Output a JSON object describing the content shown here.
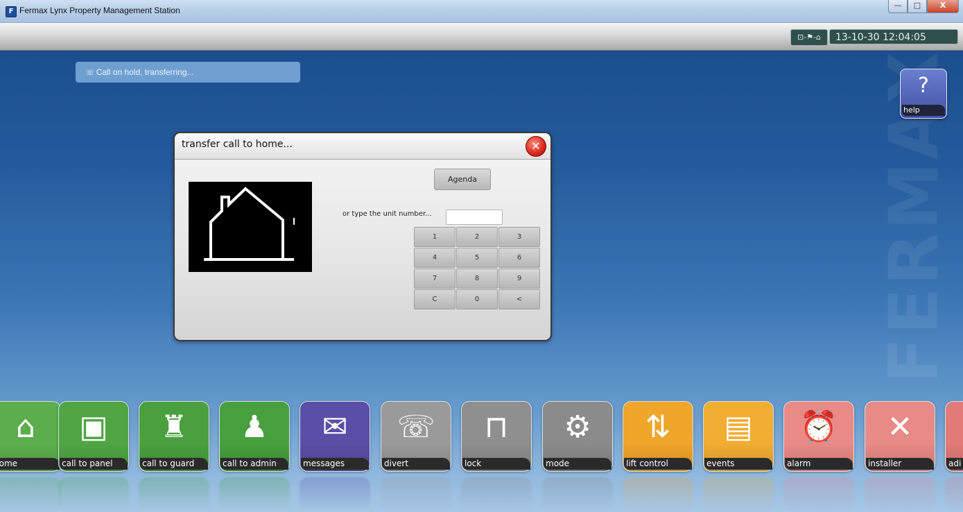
{
  "window": {
    "title": "Fermax Lynx Property Management Station",
    "controls": {
      "minimize": "—",
      "maximize": "□",
      "close": "X"
    }
  },
  "header": {
    "status_icons": "⊡-⚑-⌂",
    "datetime": "13-10-30 12:04:05"
  },
  "status": {
    "message": "Call on hold, transferring..."
  },
  "help": {
    "label": "help",
    "glyph": "?"
  },
  "watermark": "FERMAX",
  "dialog": {
    "title": "transfer call to home...",
    "agenda_label": "Agenda",
    "unit_prompt": "or type the unit number...",
    "unit_value": "",
    "keys": [
      "1",
      "2",
      "3",
      "4",
      "5",
      "6",
      "7",
      "8",
      "9",
      "C",
      "0",
      "<"
    ]
  },
  "dock": [
    {
      "label": "home",
      "icon": "house-icon",
      "color": "#5cae4c",
      "glyph": "⌂"
    },
    {
      "label": "call to panel",
      "icon": "panel-icon",
      "color": "#4fa643",
      "glyph": "▣"
    },
    {
      "label": "call to guard",
      "icon": "guard-icon",
      "color": "#4aa03f",
      "glyph": "♜"
    },
    {
      "label": "call to admin",
      "icon": "admin-icon",
      "color": "#47a03d",
      "glyph": "♟"
    },
    {
      "label": "messages",
      "icon": "envelope-icon",
      "color": "#5a4ea6",
      "glyph": "✉"
    },
    {
      "label": "divert",
      "icon": "divert-phone-icon",
      "color": "#9a9a9a",
      "glyph": "☏"
    },
    {
      "label": "lock",
      "icon": "padlock-icon",
      "color": "#8f8f8f",
      "glyph": "⊓"
    },
    {
      "label": "mode",
      "icon": "mode-house-gear-icon",
      "color": "#8b8b8b",
      "glyph": "⚙"
    },
    {
      "label": "lift control",
      "icon": "lift-icon",
      "color": "#f0a52b",
      "glyph": "⇅"
    },
    {
      "label": "events",
      "icon": "events-docs-icon",
      "color": "#f2ad33",
      "glyph": "▤"
    },
    {
      "label": "alarm",
      "icon": "alarm-bell-icon",
      "color": "#e98a86",
      "glyph": "⏰"
    },
    {
      "label": "installer",
      "icon": "tools-icon",
      "color": "#e88a86",
      "glyph": "✕"
    },
    {
      "label": "adi",
      "icon": "partial-icon",
      "color": "#e27b78",
      "glyph": ""
    }
  ],
  "colors": {
    "background_top": "#1c4e8e",
    "background_bottom": "#a8c8e6",
    "dialog_close": "#d7261a"
  }
}
